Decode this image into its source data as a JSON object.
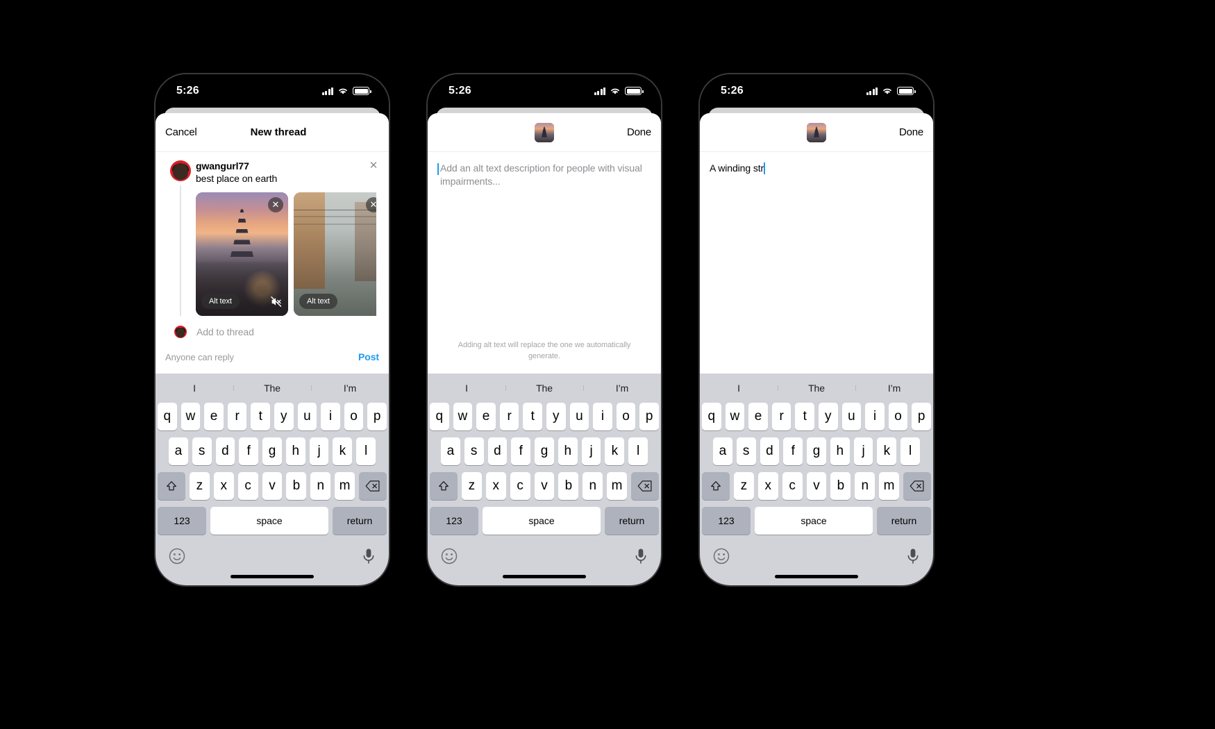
{
  "status_bar": {
    "time": "5:26",
    "signal_icon": "cellular-bars-icon",
    "wifi_icon": "wifi-icon",
    "battery_icon": "battery-icon"
  },
  "accent_colors": {
    "link_blue": "#1d9bf0",
    "caret_blue": "#1d9bf0",
    "keyboard_bg": "#d1d3d9",
    "key_bg": "#ffffff",
    "function_key_bg": "#aeb2bc",
    "placeholder_gray": "#8e8e93",
    "hint_gray": "#a6a6a6"
  },
  "phone_1": {
    "navbar": {
      "cancel_label": "Cancel",
      "title": "New thread"
    },
    "post": {
      "username": "gwangurl77",
      "text": "best place on earth",
      "avatar_icon": "user-avatar",
      "close_icon": "close-icon"
    },
    "media": [
      {
        "alt_badge_label": "Alt text",
        "remove_icon": "close-icon",
        "mute_icon": "speaker-muted-icon",
        "description": "pagoda-at-sunset"
      },
      {
        "alt_badge_label": "Alt text",
        "remove_icon": "close-icon",
        "description": "street-with-cyclist"
      },
      {
        "description": "third-photo-partial"
      }
    ],
    "add_to_thread": {
      "label": "Add to thread",
      "avatar_icon": "user-avatar-small"
    },
    "footer": {
      "reply_policy": "Anyone can reply",
      "post_label": "Post"
    }
  },
  "phone_2": {
    "navbar": {
      "thumbnail_icon": "media-thumbnail",
      "done_label": "Done"
    },
    "alt_text": {
      "value": "",
      "placeholder": "Add an alt text description for people with visual impairments..."
    },
    "hint": "Adding alt text will replace the one we automatically generate."
  },
  "phone_3": {
    "navbar": {
      "thumbnail_icon": "media-thumbnail",
      "done_label": "Done"
    },
    "alt_text": {
      "value": "A winding str",
      "placeholder": "Add an alt text description for people with visual impairments..."
    }
  },
  "keyboard": {
    "suggestions": [
      "I",
      "The",
      "I’m"
    ],
    "row1": [
      "q",
      "w",
      "e",
      "r",
      "t",
      "y",
      "u",
      "i",
      "o",
      "p"
    ],
    "row2": [
      "a",
      "s",
      "d",
      "f",
      "g",
      "h",
      "j",
      "k",
      "l"
    ],
    "row3": [
      "z",
      "x",
      "c",
      "v",
      "b",
      "n",
      "m"
    ],
    "shift_icon": "shift-icon",
    "backspace_icon": "backspace-icon",
    "numbers_label": "123",
    "space_label": "space",
    "return_label": "return",
    "emoji_icon": "emoji-icon",
    "microphone_icon": "microphone-icon"
  }
}
